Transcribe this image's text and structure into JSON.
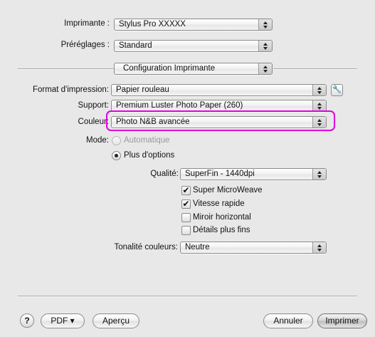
{
  "printer": {
    "label": "Imprimante :",
    "value": "Stylus Pro XXXXX"
  },
  "presets": {
    "label": "Préréglages :",
    "value": "Standard"
  },
  "panel": {
    "value": "Configuration Imprimante"
  },
  "paper_format": {
    "label": "Format d'impression:",
    "value": "Papier rouleau"
  },
  "support": {
    "label": "Support:",
    "value": "Premium Luster Photo Paper (260)"
  },
  "color": {
    "label": "Couleur:",
    "value": "Photo N&B avancée",
    "highlight_color": "#e000e0"
  },
  "mode": {
    "label": "Mode:",
    "options": [
      {
        "label": "Automatique",
        "selected": false,
        "enabled": false
      },
      {
        "label": "Plus d'options",
        "selected": true,
        "enabled": true
      }
    ]
  },
  "quality": {
    "label": "Qualité:",
    "value": "SuperFin - 1440dpi"
  },
  "checkboxes": [
    {
      "label": "Super MicroWeave",
      "checked": true
    },
    {
      "label": "Vitesse rapide",
      "checked": true
    },
    {
      "label": "Miroir horizontal",
      "checked": false
    },
    {
      "label": "Détails plus fins",
      "checked": false
    }
  ],
  "tone": {
    "label": "Tonalité couleurs:",
    "value": "Neutre"
  },
  "buttons": {
    "help": "?",
    "pdf": "PDF ▾",
    "preview": "Aperçu",
    "cancel": "Annuler",
    "print": "Imprimer"
  },
  "icons": {
    "wrench": "wrench-icon",
    "popup_arrows": "up-down-arrows-icon",
    "checkmark": "✔"
  }
}
